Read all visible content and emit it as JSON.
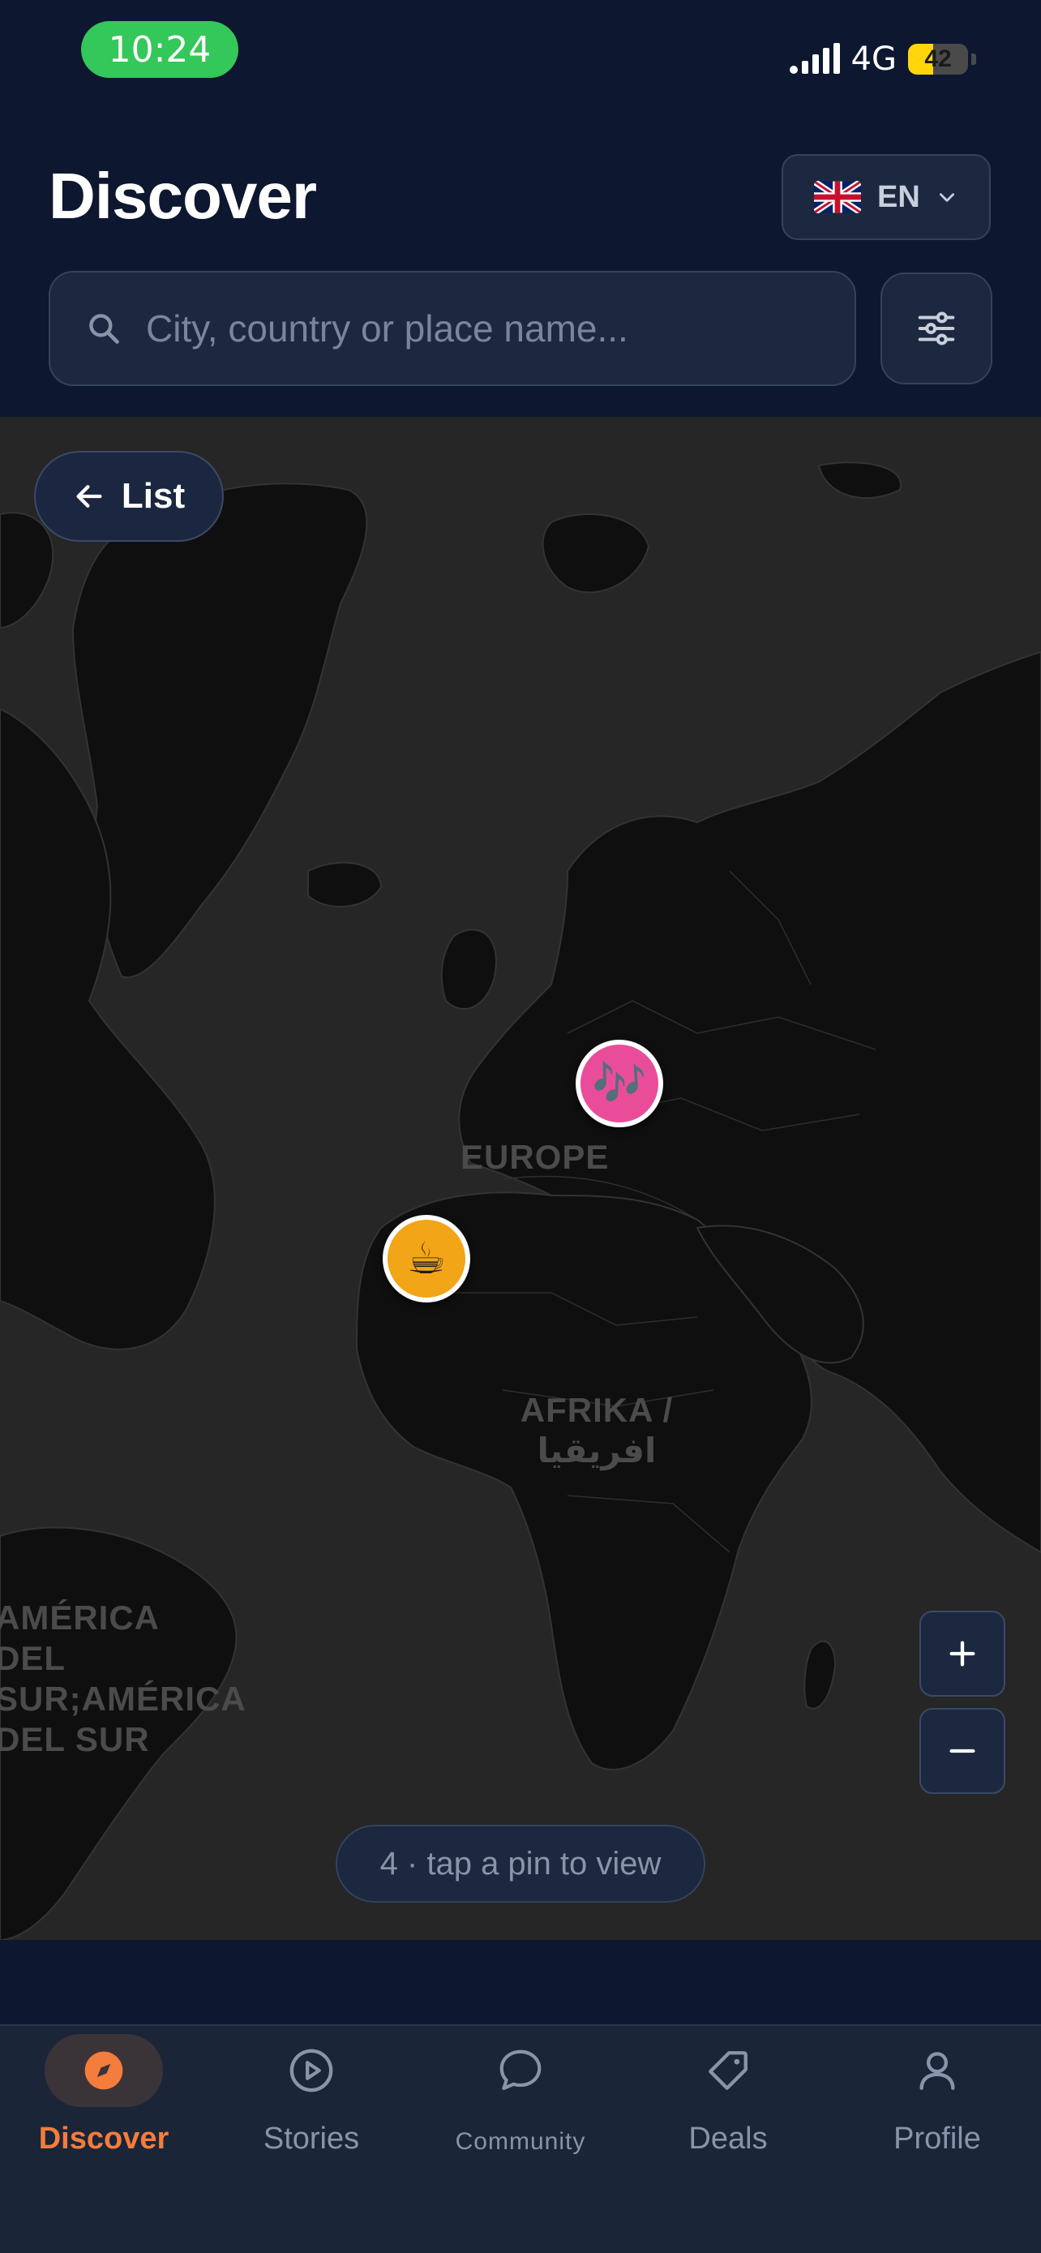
{
  "status_bar": {
    "time": "10:24",
    "network": "4G",
    "battery": "42",
    "battery_level": 0.42
  },
  "header": {
    "title": "Discover",
    "language": {
      "code": "EN",
      "flag": "uk-flag-icon"
    },
    "search": {
      "placeholder": "City, country or place name...",
      "value": ""
    }
  },
  "map": {
    "back_button_label": "List",
    "region_labels": {
      "europe": "EUROPE",
      "africa": "AFRIKA / افريقيا",
      "south_america": "AMÉRICA\nDEL SUR;AMÉRICA\nDEL SUR"
    },
    "pins": [
      {
        "name": "music-pin",
        "icon": "🎶",
        "color": "#e94d9a"
      },
      {
        "name": "coffee-pin",
        "icon": "☕",
        "color": "#f2a516"
      }
    ],
    "zoom_in": "+",
    "zoom_out": "−",
    "hint": "4 · tap a pin to view"
  },
  "bottom_nav": {
    "items": [
      {
        "label": "Discover",
        "icon": "compass-icon",
        "active": true
      },
      {
        "label": "Stories",
        "icon": "play-circle-icon",
        "active": false
      },
      {
        "label": "Community",
        "icon": "chat-bubble-icon",
        "active": false
      },
      {
        "label": "Deals",
        "icon": "tag-icon",
        "active": false
      },
      {
        "label": "Profile",
        "icon": "person-icon",
        "active": false
      }
    ],
    "active_color": "#f47c3c"
  }
}
